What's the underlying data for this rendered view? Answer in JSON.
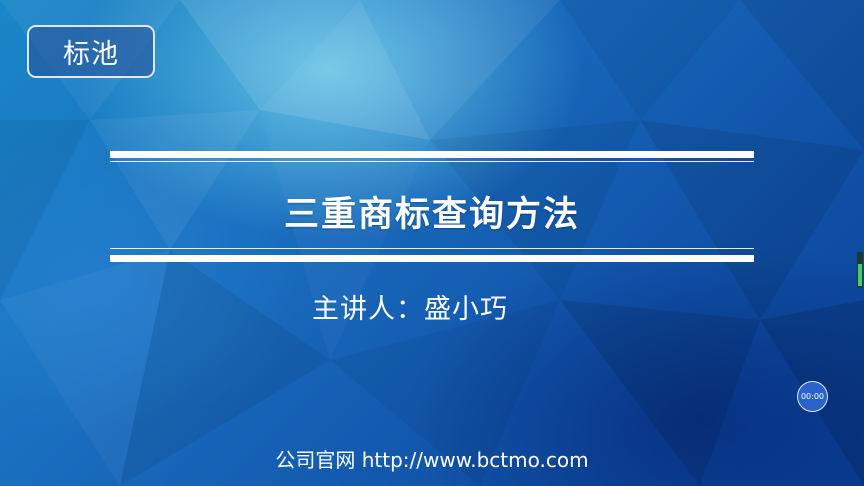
{
  "brand": {
    "label": "标池"
  },
  "slide": {
    "title": "三重商标查询方法",
    "presenter": "主讲人：盛小巧",
    "footer": "公司官网 http://www.bctmo.com"
  },
  "player": {
    "timer": "00:00"
  },
  "colors": {
    "background_dark": "#0d4c9e",
    "background_light": "#6fd3e8",
    "text": "#ffffff",
    "timer_fill": "#2a63c8",
    "indicator_green": "#3fd16a"
  }
}
